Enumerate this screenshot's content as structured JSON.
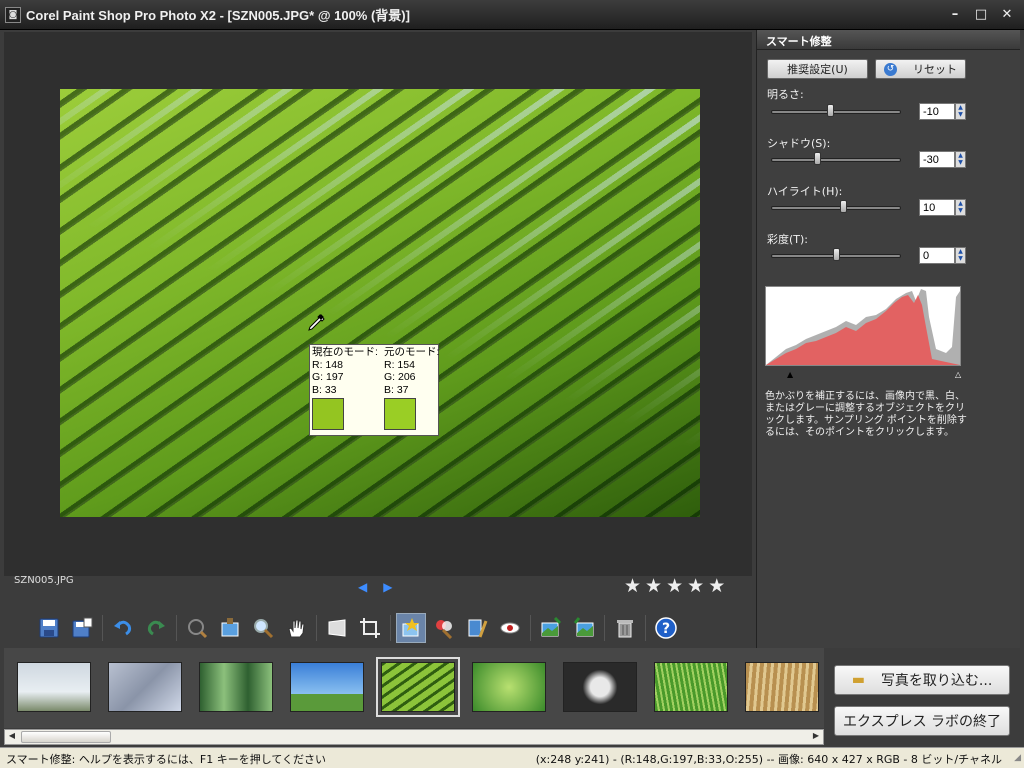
{
  "window": {
    "title": "Corel Paint Shop Pro Photo X2 - [SZN005.JPG* @ 100% (背景)]",
    "app_icon": "camera-icon"
  },
  "canvas": {
    "filename": "SZN005.JPG",
    "sample_popup": {
      "current_label": "現在のモード:",
      "current_r": "R: 148",
      "current_g": "G: 197",
      "current_b": "B: 33",
      "current_color": "#94c521",
      "original_label": "元のモード:",
      "original_r": "R: 154",
      "original_g": "G: 206",
      "original_b": "B: 37",
      "original_color": "#9ace25"
    },
    "rating_stars": 5
  },
  "panel": {
    "title": "スマート修整",
    "suggest_button": "推奨設定(U)",
    "reset_button": "リセット",
    "sliders": [
      {
        "label": "明るさ:",
        "value": "-10",
        "level": 0.45
      },
      {
        "label": "シャドウ(S):",
        "value": "-30",
        "level": 0.35
      },
      {
        "label": "ハイライト(H):",
        "value": "10",
        "level": 0.55
      },
      {
        "label": "彩度(T):",
        "value": "0",
        "level": 0.5
      }
    ],
    "help_text": "色かぶりを補正するには、画像内で黒、白、またはグレーに調整するオブジェクトをクリックします。サンプリング ポイントを削除するには、そのポイントをクリックします。"
  },
  "toolbar": {
    "tools": [
      "save-icon",
      "save-as-icon",
      "undo-icon",
      "redo-icon",
      "red-eye-icon",
      "straighten-icon",
      "zoom-icon",
      "pan-hand-icon",
      "perspective-icon",
      "crop-icon",
      "smart-fix-icon",
      "color-icon",
      "levels-icon",
      "eye-icon",
      "photo-adjust-icon",
      "photo-export-icon",
      "delete-icon",
      "help-icon"
    ]
  },
  "thumbnails": [
    {
      "name": "winter-tree",
      "color1": "#cfd8e0",
      "color2": "#7a8a6a"
    },
    {
      "name": "frost",
      "color1": "#b8c0d0",
      "color2": "#8a94a8"
    },
    {
      "name": "forest",
      "color1": "#2e6030",
      "color2": "#8cc07c"
    },
    {
      "name": "tree-sky",
      "color1": "#3a7fd8",
      "color2": "#5a9a3a"
    },
    {
      "name": "palm-leaf",
      "color1": "#8cc43a",
      "color2": "#2f5e10"
    },
    {
      "name": "leaves",
      "color1": "#3a8a2a",
      "color2": "#b8e070"
    },
    {
      "name": "dandelion",
      "color1": "#2a2a2a",
      "color2": "#e8e8e8"
    },
    {
      "name": "grass",
      "color1": "#4a9a2a",
      "color2": "#a0d060"
    },
    {
      "name": "reeds",
      "color1": "#b89050",
      "color2": "#e0c890"
    }
  ],
  "buttons": {
    "import_photos": "写真を取り込む...",
    "exit_express": "エクスプレス ラボの終了"
  },
  "status": {
    "left": "スマート修整: ヘルプを表示するには、F1 キーを押してください",
    "right": "(x:248 y:241) - (R:148,G:197,B:33,O:255) -- 画像:  640 x 427 x RGB - 8 ビット/チャネル"
  }
}
